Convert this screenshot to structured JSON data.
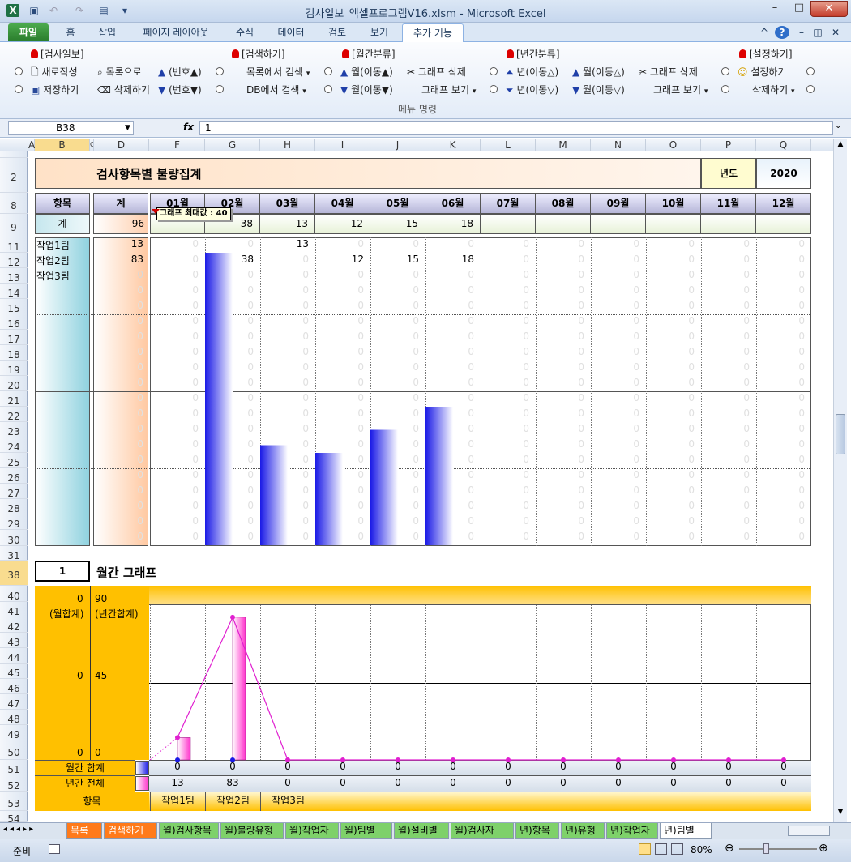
{
  "window": {
    "title": "검사일보_엑셀프로그램V16.xlsm  -  Microsoft Excel"
  },
  "tabs": {
    "file": "파일",
    "home": "홈",
    "insert": "삽입",
    "layout": "페이지 레이아웃",
    "formulas": "수식",
    "data": "데이터",
    "review": "검토",
    "view": "보기",
    "addins": "추가 기능"
  },
  "ribbon": {
    "g1": "[검사일보]",
    "g2": "[검색하기]",
    "g3": "[월간분류]",
    "g4": "[년간분류]",
    "g5": "[설정하기]",
    "new": "새로작성",
    "list": "목록으로",
    "num_up": "(번호▲)",
    "save": "저장하기",
    "delete": "삭제하기",
    "num_down": "(번호▼)",
    "search_list": "목록에서 검색",
    "search_db": "DB에서 검색",
    "month_up": "월(이동▲)",
    "month_down": "월(이동▼)",
    "graph_del": "그래프 삭제",
    "graph_view": "그래프 보기",
    "year_up": "년(이동△)",
    "year_down": "년(이동▽)",
    "month_up2": "월(이동△)",
    "month_down2": "월(이동▽)",
    "graph_del2": "그래프 삭제",
    "graph_view2": "그래프 보기",
    "settings": "설정하기",
    "delete2": "삭제하기",
    "caption": "메뉴 명령"
  },
  "formula_bar": {
    "name_box": "B38",
    "fx": "fx",
    "value": "1"
  },
  "columns": [
    "A",
    "B",
    "C",
    "D",
    "F",
    "G",
    "H",
    "I",
    "J",
    "K",
    "L",
    "M",
    "N",
    "O",
    "P",
    "Q"
  ],
  "rows": [
    "2",
    "8",
    "9",
    "11",
    "12",
    "13",
    "14",
    "15",
    "16",
    "17",
    "18",
    "19",
    "20",
    "21",
    "22",
    "23",
    "24",
    "25",
    "26",
    "27",
    "28",
    "29",
    "30",
    "31",
    "38",
    "40",
    "41",
    "42",
    "43",
    "44",
    "45",
    "46",
    "47",
    "48",
    "49",
    "50",
    "51",
    "52",
    "53",
    "54"
  ],
  "report": {
    "title": "검사항목별 불량집계",
    "year_label": "년도",
    "year": "2020",
    "item_header": "항목",
    "total_header": "계",
    "months": [
      "01월",
      "02월",
      "03월",
      "04월",
      "05월",
      "06월",
      "07월",
      "08월",
      "09월",
      "10월",
      "11월",
      "12월"
    ],
    "total_row_label": "계",
    "total": "96",
    "month_totals": [
      "",
      "38",
      "13",
      "12",
      "15",
      "18",
      "",
      "",
      "",
      "",
      "",
      ""
    ],
    "teams": [
      "작업1팀",
      "작업2팀",
      "작업3팀"
    ],
    "team_totals": [
      "13",
      "83",
      "0"
    ],
    "team1_cells": [
      "0",
      "0",
      "13",
      "0",
      "0",
      "0",
      "0",
      "0",
      "0",
      "0",
      "0",
      "0"
    ],
    "team2_cells": [
      "0",
      "38",
      "0",
      "12",
      "15",
      "18",
      "0",
      "0",
      "0",
      "0",
      "0",
      "0"
    ],
    "zero": "0",
    "tooltip": "그래프 최대값 : 40",
    "bar_max": 40,
    "bar_values": [
      0,
      38,
      13,
      12,
      15,
      18,
      0,
      0,
      0,
      0,
      0,
      0
    ]
  },
  "monthly_graph": {
    "index": "1",
    "title": "월간 그래프",
    "left_axis": [
      "0",
      "0",
      "0"
    ],
    "left_axis_label": "(월합계)",
    "right_axis": [
      "90",
      "45",
      "0"
    ],
    "right_axis_label": "(년간합계)",
    "row_monthly_label": "월간 합계",
    "row_annual_label": "년간 전체",
    "row_item_label": "항목",
    "monthly_totals": [
      "0",
      "0",
      "0",
      "0",
      "0",
      "0",
      "0",
      "0",
      "0",
      "0",
      "0",
      "0"
    ],
    "annual_totals": [
      "13",
      "83",
      "0",
      "0",
      "0",
      "0",
      "0",
      "0",
      "0",
      "0",
      "0",
      "0"
    ],
    "items": [
      "작업1팀",
      "작업2팀",
      "작업3팀",
      "",
      "",
      "",
      "",
      "",
      "",
      "",
      "",
      ""
    ],
    "bar_max": 90,
    "annual_values": [
      13,
      83,
      0,
      0,
      0,
      0,
      0,
      0,
      0,
      0,
      0,
      0
    ]
  },
  "sheet_tabs": [
    "목록",
    "검색하기",
    "월)검사항목",
    "월)불량유형",
    "월)작업자",
    "월)팀별",
    "월)설비별",
    "월)검사자",
    "년)항목",
    "년)유형",
    "년)작업자",
    "년)팀별"
  ],
  "status": {
    "ready": "준비",
    "zoom": "80%"
  },
  "colors": {
    "bar_blue": "#1a1ae6",
    "bar_pink": "#ff33cc",
    "line": "#e020d0",
    "header_orange": "#ffc000",
    "accent_teal": "#9ed7e2"
  }
}
